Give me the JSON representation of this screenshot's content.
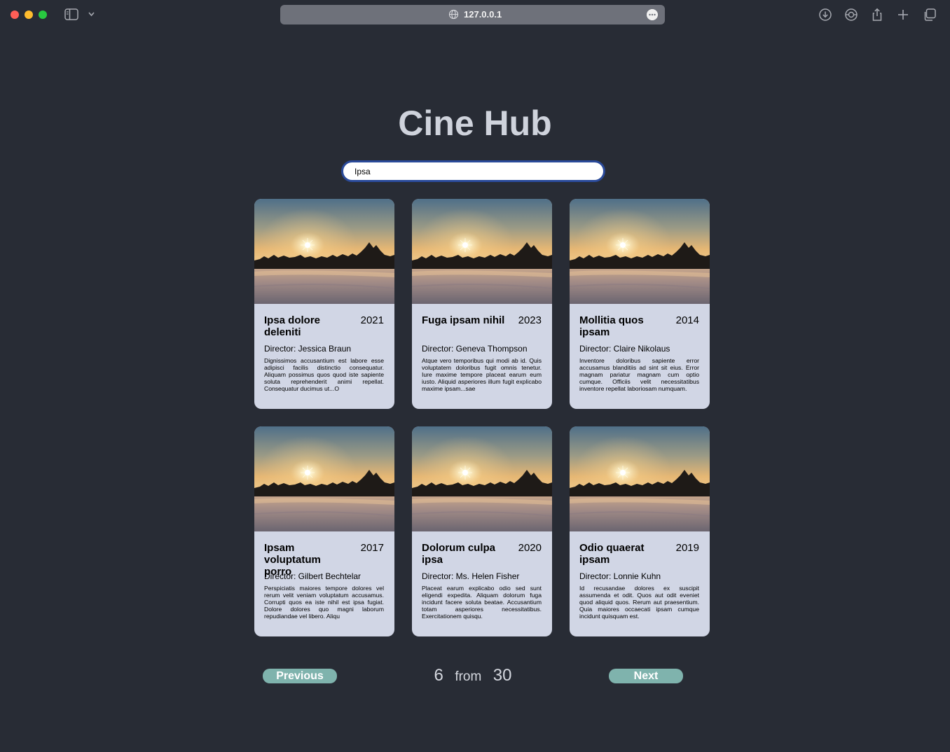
{
  "browser": {
    "url": "127.0.0.1",
    "colors": {
      "red": "#fe5f57",
      "yellow": "#febc2e",
      "green": "#28c840"
    }
  },
  "page": {
    "title": "Cine Hub",
    "search": {
      "value": "Ipsa",
      "placeholder": ""
    }
  },
  "movies": [
    {
      "title": "Ipsa dolore deleniti",
      "year": "2021",
      "director": "Director: Jessica Braun",
      "description": "Dignissimos accusantium est labore esse adipisci facilis distinctio consequatur. Aliquam possimus quos quod iste sapiente soluta reprehenderit animi repellat. Consequatur ducimus ut...O"
    },
    {
      "title": "Fuga ipsam nihil",
      "year": "2023",
      "director": "Director: Geneva Thompson",
      "description": "Atque vero temporibus qui modi ab id. Quis voluptatem doloribus fugit omnis tenetur. Iure maxime tempore placeat earum eum iusto. Aliquid asperiores illum fugit explicabo maxime ipsam...sae"
    },
    {
      "title": "Mollitia quos ipsam",
      "year": "2014",
      "director": "Director: Claire Nikolaus",
      "description": "Inventore doloribus sapiente error accusamus blanditiis ad sint sit eius. Error magnam pariatur magnam cum optio cumque. Officiis velit necessitatibus inventore repellat laboriosam numquam."
    },
    {
      "title": "Ipsam voluptatum porro",
      "year": "2017",
      "director": "Director: Gilbert Bechtelar",
      "description": "Perspiciatis maiores tempore dolores vel rerum velit veniam voluptatum accusamus. Corrupti quos ea iste nihil est ipsa fugiat. Dolore dolores quo magni laborum repudiandae vel libero. Aliqu"
    },
    {
      "title": "Dolorum culpa ipsa",
      "year": "2020",
      "director": "Director: Ms. Helen Fisher",
      "description": "Placeat earum explicabo odio sed sunt eligendi expedita. Aliquam dolorum fuga incidunt facere soluta beatae. Accusantium totam asperiores necessitatibus. Exercitationem quisqu."
    },
    {
      "title": "Odio quaerat ipsam",
      "year": "2019",
      "director": "Director: Lonnie Kuhn",
      "description": "Id recusandae dolores ex suscipit assumenda et odit. Quos aut odit eveniet quod aliquid quos. Rerum aut praesentium. Quia maiores occaecati ipsam cumque incidunt quisquam est."
    }
  ],
  "pagination": {
    "previous_label": "Previous",
    "next_label": "Next",
    "current": "6",
    "separator": "from",
    "total": "30"
  }
}
